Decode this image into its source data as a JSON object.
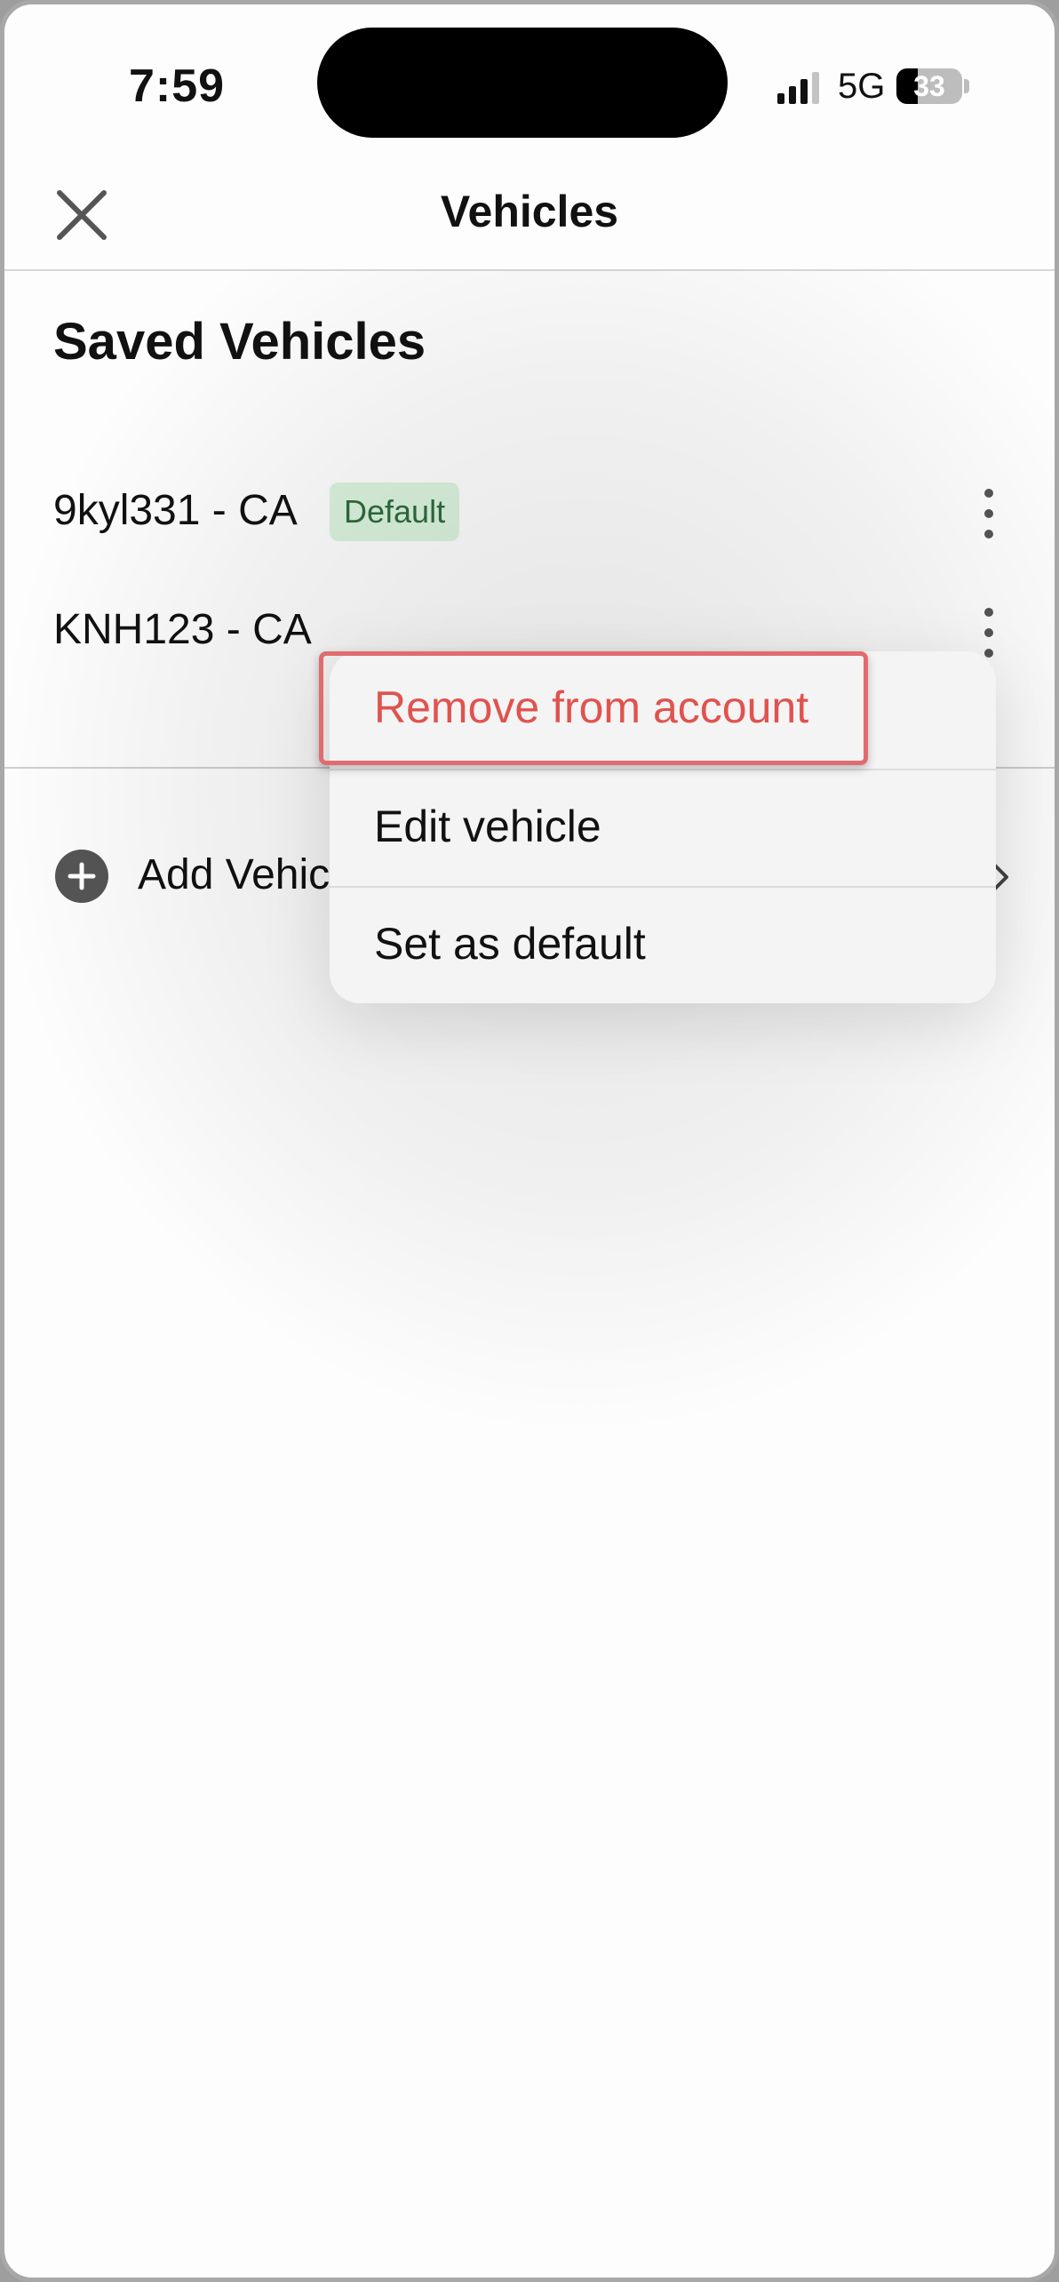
{
  "status_bar": {
    "time": "7:59",
    "network": "5G",
    "battery_percent": "33",
    "battery_level": 0.33
  },
  "nav": {
    "title": "Vehicles",
    "close_icon": "close-icon"
  },
  "section": {
    "title": "Saved Vehicles"
  },
  "vehicles": [
    {
      "plate": "9kyl331 - CA",
      "badge": "Default"
    },
    {
      "plate": "KNH123 - CA"
    }
  ],
  "add_vehicle": {
    "label": "Add Vehic",
    "icon": "plus-circle-icon"
  },
  "context_menu": {
    "items": [
      {
        "label": "Remove from account",
        "style": "destructive"
      },
      {
        "label": "Edit vehicle"
      },
      {
        "label": "Set as default"
      }
    ]
  },
  "colors": {
    "destructive": "#e0534e",
    "badge_bg": "#d9f2dd",
    "badge_text": "#2e6b3d",
    "highlight": "#e16b6f"
  }
}
